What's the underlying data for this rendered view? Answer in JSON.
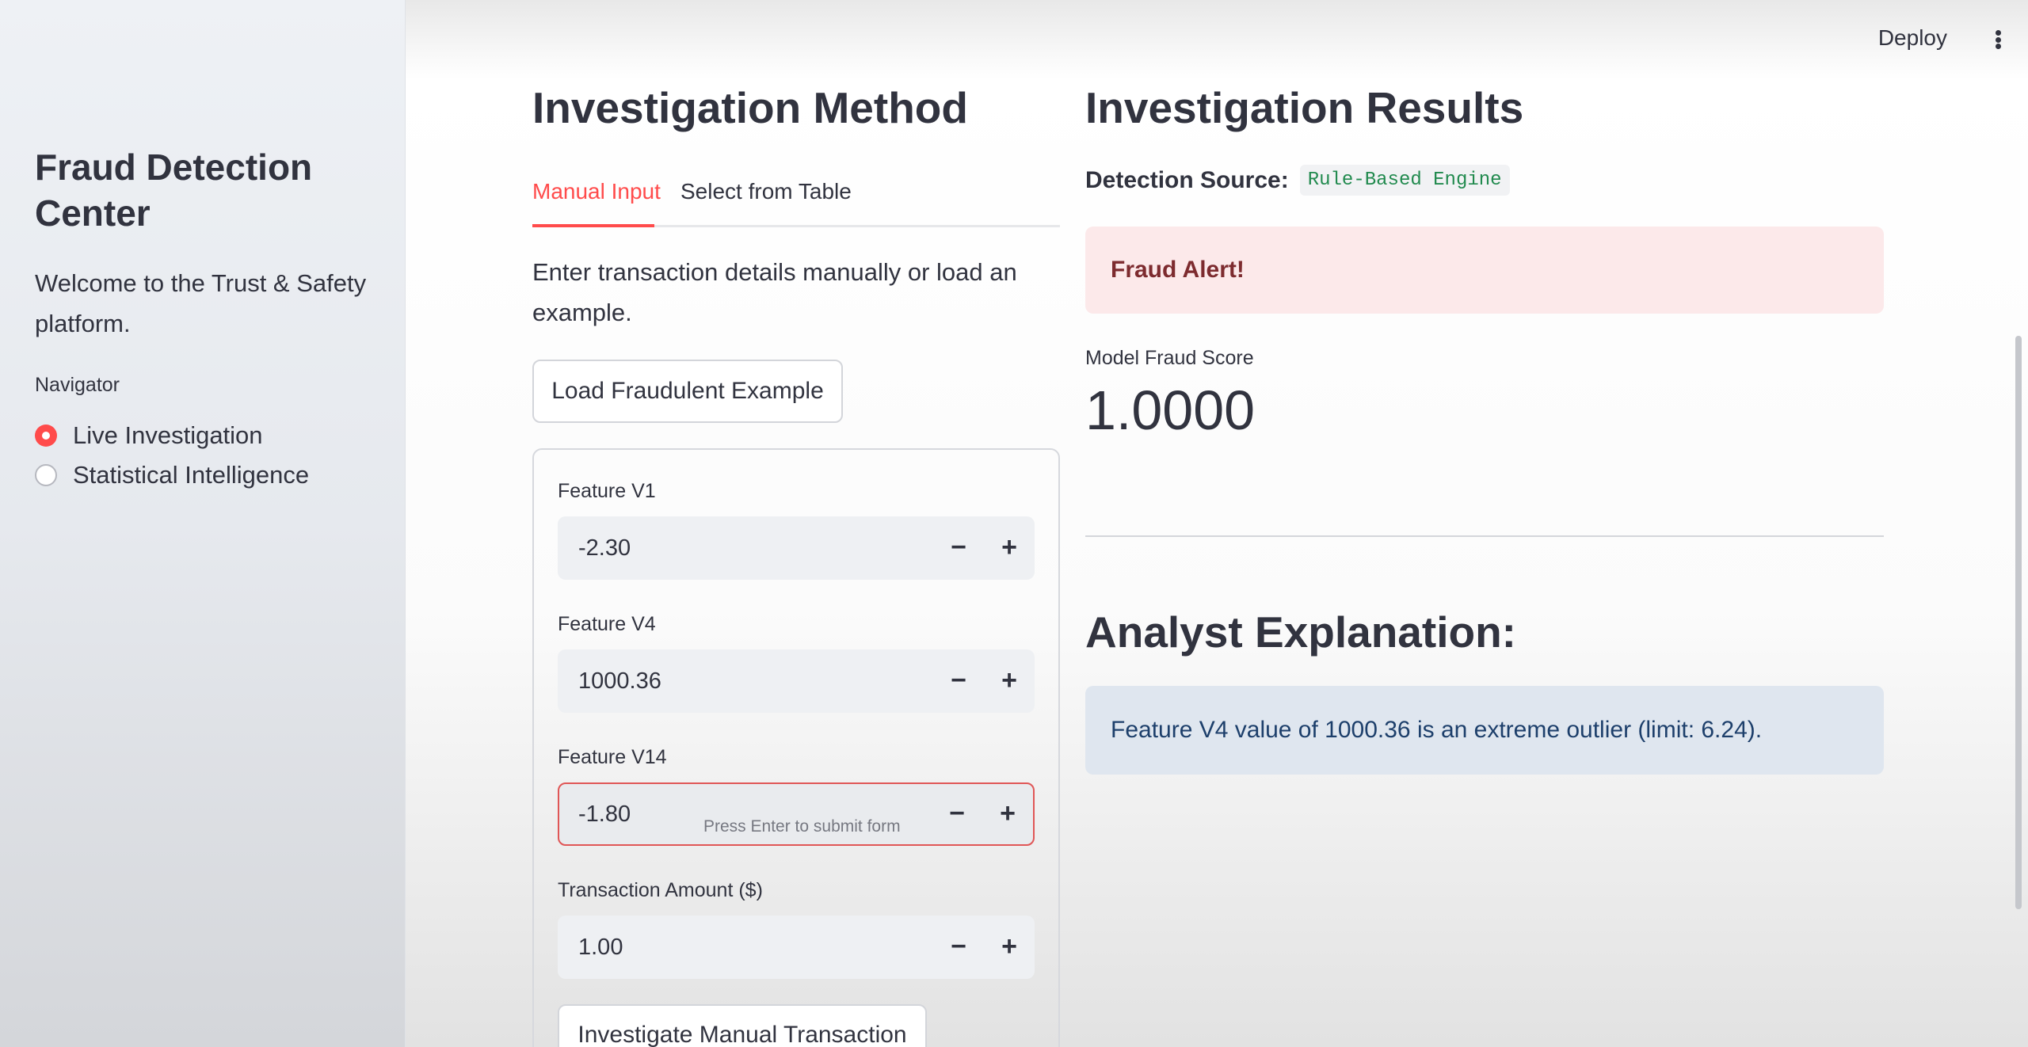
{
  "header": {
    "deploy_label": "Deploy",
    "menu_icon": "kebab-menu-icon"
  },
  "sidebar": {
    "title": "Fraud Detection Center",
    "welcome": "Welcome to the Trust & Safety platform.",
    "navigator_label": "Navigator",
    "options": [
      {
        "label": "Live Investigation",
        "selected": true
      },
      {
        "label": "Statistical Intelligence",
        "selected": false
      }
    ]
  },
  "method": {
    "heading": "Investigation Method",
    "tabs": [
      {
        "label": "Manual Input",
        "active": true
      },
      {
        "label": "Select from Table",
        "active": false
      }
    ],
    "intro": "Enter transaction details manually or load an example.",
    "load_button": "Load Fraudulent Example",
    "fields": [
      {
        "label": "Feature V1",
        "value": "-2.30"
      },
      {
        "label": "Feature V4",
        "value": "1000.36"
      },
      {
        "label": "Feature V14",
        "value": "-1.80",
        "hint": "Press Enter to submit form"
      },
      {
        "label": "Transaction Amount ($)",
        "value": "1.00"
      }
    ],
    "submit_button": "Investigate Manual Transaction"
  },
  "results": {
    "heading": "Investigation Results",
    "source_label": "Detection Source:",
    "source_value": "Rule-Based Engine",
    "alert": "Fraud Alert!",
    "score_label": "Model Fraud Score",
    "score_value": "1.0000",
    "explanation_heading": "Analyst Explanation:",
    "explanation": "Feature V4 value of 1000.36 is an extreme outlier (limit: 6.24)."
  },
  "colors": {
    "accent": "#ff4b4b",
    "alert_bg": "#fce9ea",
    "alert_text": "#7d2b2f",
    "info_bg": "#dfe6ef",
    "info_text": "#1d3f6b",
    "code_text": "#218a4e"
  }
}
